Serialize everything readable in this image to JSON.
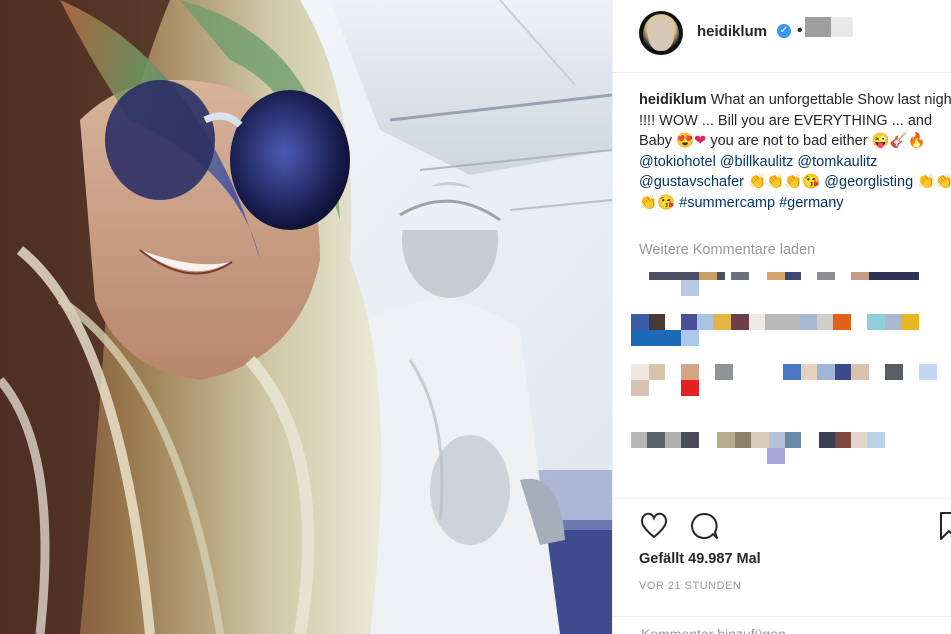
{
  "post": {
    "username": "heidiklum",
    "caption": {
      "username": "heidiklum",
      "text_1": "What an unforgettable Show last night !!!! WOW ... Bill you are EVERYTHING ... and Baby",
      "text_2": "you are not to bad either",
      "mention_1": "@tokiohotel",
      "mention_2": "@billkaulitz",
      "mention_3": "@tomkaulitz",
      "mention_4": "@gustavschafer",
      "mention_5": "@georglisting",
      "hashtag_1": "#summercamp",
      "hashtag_2": "#germany"
    },
    "load_more_label": "Weitere Kommentare laden",
    "likes_label": "Gefällt 49.987 Mal",
    "time_label": "VOR 21 STUNDEN",
    "comment_placeholder": "Kommentar hinzufügen ..."
  },
  "icons": {
    "verified": "verified-badge-icon",
    "like": "heart-icon",
    "comment": "comment-bubble-icon",
    "save": "bookmark-icon"
  },
  "colors": {
    "verified_blue": "#3897f0",
    "link_blue": "#003569",
    "secondary_text": "#999999",
    "border": "#efefef"
  }
}
